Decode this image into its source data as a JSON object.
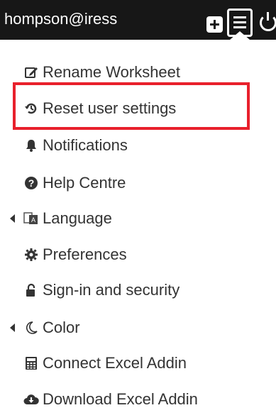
{
  "header": {
    "user_email": "hompson@iress",
    "bg_color": "#171717"
  },
  "menu": {
    "items": [
      {
        "label": "Rename Worksheet",
        "icon": "edit-icon",
        "submenu": false
      },
      {
        "label": "Reset user settings",
        "icon": "history-icon",
        "submenu": false,
        "highlighted": true
      },
      {
        "label": "Notifications",
        "icon": "bell-icon",
        "submenu": false
      },
      {
        "label": "Help Centre",
        "icon": "question-circle-icon",
        "submenu": false
      },
      {
        "label": "Language",
        "icon": "language-icon",
        "submenu": true
      },
      {
        "label": "Preferences",
        "icon": "cog-icon",
        "submenu": false
      },
      {
        "label": "Sign-in and security",
        "icon": "unlock-icon",
        "submenu": false
      },
      {
        "label": "Color",
        "icon": "moon-icon",
        "submenu": true
      },
      {
        "label": "Connect Excel Addin",
        "icon": "calculator-icon",
        "submenu": false
      },
      {
        "label": "Download Excel Addin",
        "icon": "cloud-download-icon",
        "submenu": false
      }
    ]
  },
  "colors": {
    "highlight": "#e8202c",
    "text": "#333333"
  }
}
